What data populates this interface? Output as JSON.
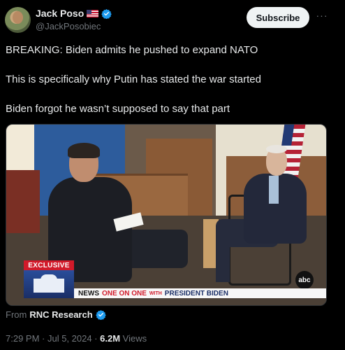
{
  "author": {
    "name": "Jack Poso",
    "flag": "us-flag-icon",
    "verified": true,
    "handle": "@JackPosobiec"
  },
  "actions": {
    "subscribe_label": "Subscribe",
    "more_label": "···"
  },
  "tweet": {
    "lines": [
      "BREAKING: Biden admits he pushed to expand NATO",
      "This is specifically why Putin has stated the war started",
      "Biden forgot he wasn’t supposed to say that part"
    ]
  },
  "media": {
    "badge": "EXCLUSIVE",
    "network_logo": "abc",
    "lower_third": {
      "brand": "NEWS",
      "show": "ONE ON ONE",
      "with": "WITH",
      "guest": "PRESIDENT BIDEN"
    }
  },
  "source": {
    "prefix": "From",
    "name": "RNC Research",
    "verified": true
  },
  "meta": {
    "time": "7:29 PM · Jul 5, 2024 ·",
    "views_count": "6.2M",
    "views_label": "Views"
  },
  "colors": {
    "verified": "#1d9bf0",
    "muted": "#71767b",
    "text": "#e7e9ea",
    "background": "#000000"
  }
}
